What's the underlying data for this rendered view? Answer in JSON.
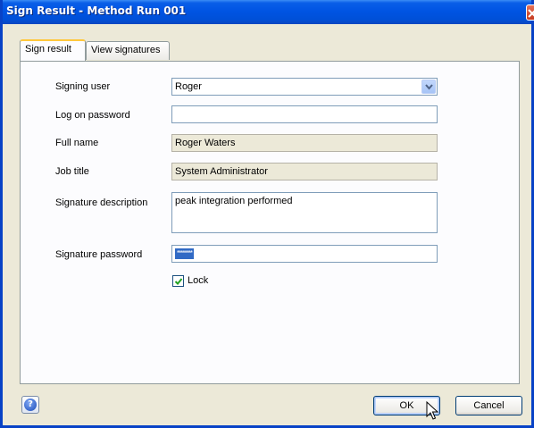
{
  "window": {
    "title": "Sign Result - Method Run  001"
  },
  "tabs": [
    {
      "label": "Sign result",
      "active": true
    },
    {
      "label": "View signatures",
      "active": false
    }
  ],
  "form": {
    "signing_user": {
      "label": "Signing user",
      "value": "Roger"
    },
    "logon_password": {
      "label": "Log on password",
      "value": ""
    },
    "full_name": {
      "label": "Full name",
      "value": "Roger Waters"
    },
    "job_title": {
      "label": "Job title",
      "value": "System Administrator"
    },
    "signature_description": {
      "label": "Signature description",
      "value": "peak integration performed"
    },
    "signature_password": {
      "label": "Signature password",
      "masked_value": "********"
    },
    "lock": {
      "label": "Lock",
      "checked": true
    }
  },
  "buttons": {
    "ok": "OK",
    "cancel": "Cancel"
  },
  "icons": {
    "close": "close-icon",
    "dropdown": "chevron-down-icon",
    "help": "help-icon",
    "check": "check-icon",
    "cursor": "mouse-pointer-icon"
  }
}
